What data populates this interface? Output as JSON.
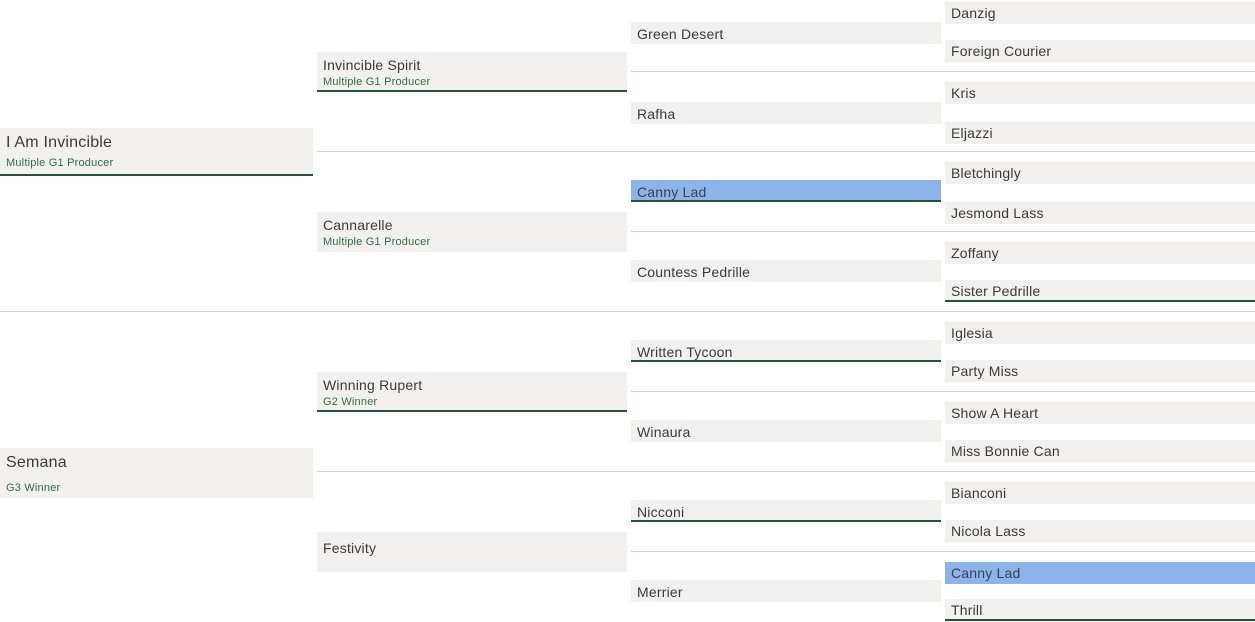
{
  "pedigree": {
    "gen1": [
      {
        "name": "I Am Invincible",
        "note": "Multiple G1 Producer"
      },
      {
        "name": "Semana",
        "note": "G3 Winner"
      }
    ],
    "gen2": [
      {
        "name": "Invincible Spirit",
        "note": "Multiple G1 Producer"
      },
      {
        "name": "Cannarelle",
        "note": "Multiple G1 Producer"
      },
      {
        "name": "Winning Rupert",
        "note": "G2 Winner"
      },
      {
        "name": "Festivity"
      }
    ],
    "gen3": [
      {
        "name": "Green Desert"
      },
      {
        "name": "Rafha"
      },
      {
        "name": "Canny Lad",
        "highlighted": true
      },
      {
        "name": "Countess Pedrille"
      },
      {
        "name": "Written Tycoon"
      },
      {
        "name": "Winaura"
      },
      {
        "name": "Nicconi"
      },
      {
        "name": "Merrier"
      }
    ],
    "gen4": [
      {
        "name": "Danzig"
      },
      {
        "name": "Foreign Courier"
      },
      {
        "name": "Kris"
      },
      {
        "name": "Eljazzi"
      },
      {
        "name": "Bletchingly"
      },
      {
        "name": "Jesmond Lass"
      },
      {
        "name": "Zoffany"
      },
      {
        "name": "Sister Pedrille"
      },
      {
        "name": "Iglesia"
      },
      {
        "name": "Party Miss"
      },
      {
        "name": "Show A Heart"
      },
      {
        "name": "Miss Bonnie Can"
      },
      {
        "name": "Bianconi"
      },
      {
        "name": "Nicola Lass"
      },
      {
        "name": "Canny Lad",
        "highlighted": true
      },
      {
        "name": "Thrill"
      }
    ]
  },
  "colors": {
    "cell_background": "#f3f1ed",
    "highlight": "#8db4ea",
    "underline": "#24543a",
    "note_text": "#2f6e46"
  }
}
